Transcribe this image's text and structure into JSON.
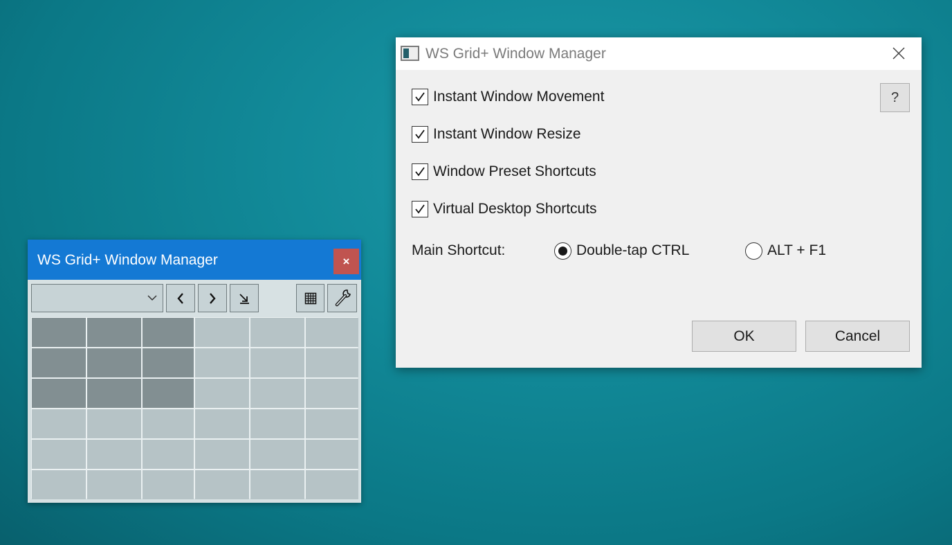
{
  "grid_window": {
    "title": "WS Grid+ Window Manager",
    "close_label": "×",
    "toolbar": {
      "combo_value": "",
      "buttons": [
        "previous-icon",
        "next-icon",
        "maximize-arrow-icon",
        "grid-icon",
        "settings-wrench-icon"
      ]
    },
    "grid": {
      "rows": 6,
      "columns": 6,
      "selected_rows": [
        0,
        1,
        2
      ],
      "selected_columns": [
        0,
        1,
        2
      ]
    }
  },
  "settings_dialog": {
    "title": "WS Grid+ Window Manager",
    "help_label": "?",
    "options": [
      {
        "label": "Instant Window Movement",
        "checked": true
      },
      {
        "label": "Instant Window Resize",
        "checked": true
      },
      {
        "label": "Window Preset Shortcuts",
        "checked": true
      },
      {
        "label": "Virtual Desktop Shortcuts",
        "checked": true
      }
    ],
    "main_shortcut": {
      "label": "Main Shortcut:",
      "choices": [
        {
          "label": "Double-tap CTRL",
          "selected": true
        },
        {
          "label": "ALT + F1",
          "selected": false
        }
      ]
    },
    "ok_label": "OK",
    "cancel_label": "Cancel"
  },
  "colors": {
    "titlebar_blue": "#1479d4",
    "close_red": "#c05450",
    "cell": "#b6c3c6",
    "cell_selected": "#828f92",
    "desktop": "#128a99"
  }
}
